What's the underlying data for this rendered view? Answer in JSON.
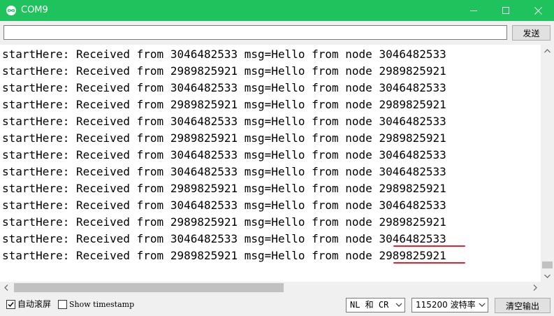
{
  "window": {
    "title": "COM9",
    "icon": "arduino-infinity-icon",
    "accent_color": "#1fc35d"
  },
  "send": {
    "input_value": "",
    "button_label": "发送"
  },
  "serial_output": {
    "lines": [
      "startHere: Received from 3046482533 msg=Hello from node 3046482533",
      "startHere: Received from 2989825921 msg=Hello from node 2989825921",
      "startHere: Received from 3046482533 msg=Hello from node 3046482533",
      "startHere: Received from 2989825921 msg=Hello from node 2989825921",
      "startHere: Received from 3046482533 msg=Hello from node 3046482533",
      "startHere: Received from 2989825921 msg=Hello from node 2989825921",
      "startHere: Received from 3046482533 msg=Hello from node 3046482533",
      "startHere: Received from 3046482533 msg=Hello from node 3046482533",
      "startHere: Received from 2989825921 msg=Hello from node 2989825921",
      "startHere: Received from 3046482533 msg=Hello from node 3046482533",
      "startHere: Received from 2989825921 msg=Hello from node 2989825921",
      "startHere: Received from 3046482533 msg=Hello from node 3046482533",
      "startHere: Received from 2989825921 msg=Hello from node 2989825921"
    ],
    "annotation_color": "#e8202a"
  },
  "status_bar": {
    "autoscroll_label": "自动滚屏",
    "autoscroll_checked": true,
    "timestamp_label": "Show timestamp",
    "timestamp_checked": false,
    "line_ending_value": "NL 和 CR",
    "baud_value": "115200 波特率",
    "clear_button_label": "清空输出"
  }
}
